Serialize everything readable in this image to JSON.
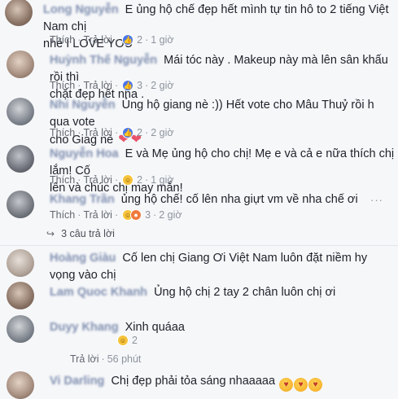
{
  "comments": [
    {
      "author": "Long Nguyễn",
      "text_line1": "E ủng hộ chế đẹp hết mình tự tin hô to 2 tiếng Việt Nam chị",
      "text_line2": "nhé I LOVE YOU",
      "like_label": "Thích",
      "reply_label": "Trả lời",
      "reaction_count": "2",
      "time": "1 giờ"
    },
    {
      "author": "Huỳnh Thế Nguyễn",
      "text_line1": "Mái tóc này . Makeup này mà lên sân khấu rồi thì",
      "text_line2": "chặt đẹp hết nha .",
      "like_label": "Thích",
      "reply_label": "Trả lời",
      "reaction_count": "3",
      "time": "2 giờ"
    },
    {
      "author": "Nhi Nguyễn",
      "text_line1": "Ủng hộ giang nè :)) Hết vote cho Mâu Thuỷ rồi h qua vote",
      "text_line2": "cho Giag nè",
      "like_label": "Thích",
      "reply_label": "Trả lời",
      "reaction_count": "2",
      "time": "2 giờ"
    },
    {
      "author": "Nguyễn Hoa",
      "text_line1": "E và Mẹ ủng hộ cho chị! Mẹ e và cả e nữa thích chị lắm! Cố",
      "text_line2": "lên và chúc chị may mắn!",
      "like_label": "Thích",
      "reply_label": "Trả lời",
      "reaction_count": "2",
      "time": "1 giờ"
    },
    {
      "author": "Khang Trần",
      "text_line1": "ủng hộ chế! cố lên nha giựt vm về nha chế ơi",
      "like_label": "Thích",
      "reply_label": "Trả lời",
      "reaction_count": "3",
      "time": "2 giờ"
    },
    {
      "author": "Hoàng Giàu",
      "text_line1": "Cố len chị Giang Ơi Việt Nam luôn đặt niềm hy vọng vào chị"
    },
    {
      "author": "Lam Quoc Khanh",
      "text_line1": "Ủng hộ chị 2 tay 2 chân luôn chị ơi"
    },
    {
      "author": "Duyy Khang",
      "text_line1": "Xinh quáaa",
      "reaction_count": "2"
    },
    {
      "author": "",
      "reply_label": "Trả lời",
      "time": "56 phút"
    },
    {
      "author": "Vi Darling",
      "text_line1": "Chị đẹp phải tỏa sáng nhaaaaa"
    }
  ],
  "replies_link": "3 câu trả lời",
  "colors": {
    "link": "#616770",
    "text": "#1d2129",
    "meta": "#8d949e",
    "like_blue": "#4a76e8",
    "heart": "#e8546b"
  }
}
